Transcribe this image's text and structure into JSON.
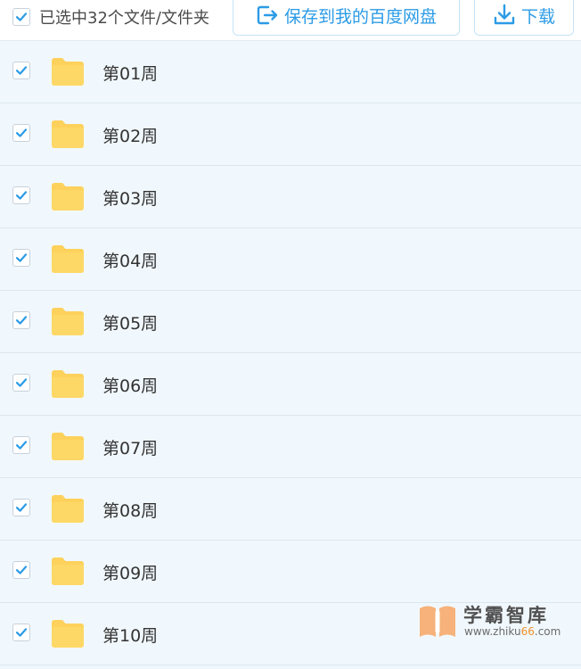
{
  "toolbar": {
    "select_all_label": "已选中32个文件/文件夹",
    "select_all_checked": true,
    "save_label": "保存到我的百度网盘",
    "save_icon": "save-to-netdisk-icon",
    "download_label": "下载",
    "download_icon": "download-icon"
  },
  "files": [
    {
      "name": "第01周",
      "checked": true,
      "type": "folder"
    },
    {
      "name": "第02周",
      "checked": true,
      "type": "folder"
    },
    {
      "name": "第03周",
      "checked": true,
      "type": "folder"
    },
    {
      "name": "第04周",
      "checked": true,
      "type": "folder"
    },
    {
      "name": "第05周",
      "checked": true,
      "type": "folder"
    },
    {
      "name": "第06周",
      "checked": true,
      "type": "folder"
    },
    {
      "name": "第07周",
      "checked": true,
      "type": "folder"
    },
    {
      "name": "第08周",
      "checked": true,
      "type": "folder"
    },
    {
      "name": "第09周",
      "checked": true,
      "type": "folder"
    },
    {
      "name": "第10周",
      "checked": true,
      "type": "folder"
    }
  ],
  "watermark": {
    "title": "学霸智库",
    "url_prefix": "www.zhiku",
    "url_accent": "66",
    "url_suffix": ".com"
  },
  "colors": {
    "accent": "#2b9be6",
    "folder": "#fdd15b",
    "row_background": "#f1f8fd",
    "watermark_accent": "#f0902a"
  }
}
